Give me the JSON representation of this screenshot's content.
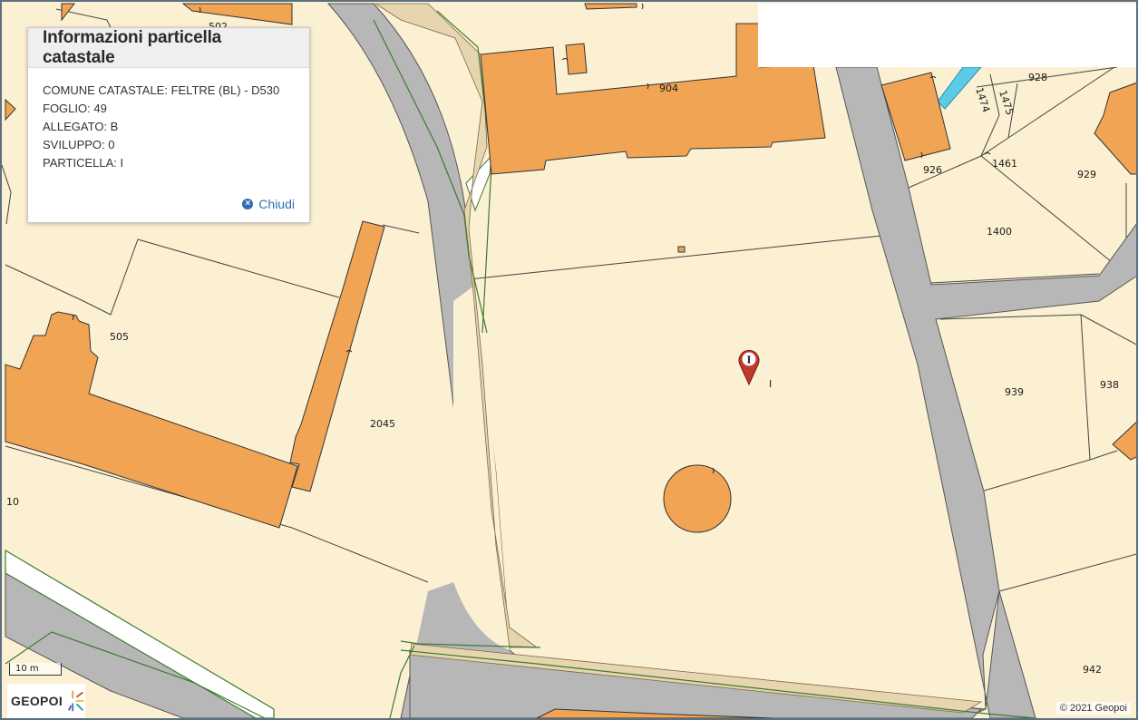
{
  "info_panel": {
    "title": "Informazioni particella catastale",
    "lines": [
      "COMUNE CATASTALE: FELTRE (BL) - D530",
      "FOGLIO: 49",
      "ALLEGATO: B",
      "SVILUPPO: 0",
      "PARTICELLA: I"
    ],
    "close_label": "Chiudi",
    "close_icon": "close-circle-icon"
  },
  "map": {
    "parcel_labels": [
      "502",
      "904",
      "928",
      "1474",
      "1475",
      "926",
      "1461",
      "929",
      "1400",
      "505",
      "2045",
      "939",
      "938",
      "I",
      "10",
      "942"
    ],
    "selected_parcel": "I",
    "marker_icon": "map-pin-icon",
    "marker_letter": "I",
    "colors": {
      "parcel": "#fcf0d2",
      "building": "#f0a454",
      "road": "#b7b7b7",
      "water": "#5ccbe8",
      "boundary": "#3d7a32",
      "marker": "#c0392b"
    }
  },
  "scale": {
    "label": "10 m"
  },
  "brand": {
    "name": "GEOPOI"
  },
  "copyright": "© 2021 Geopoi"
}
